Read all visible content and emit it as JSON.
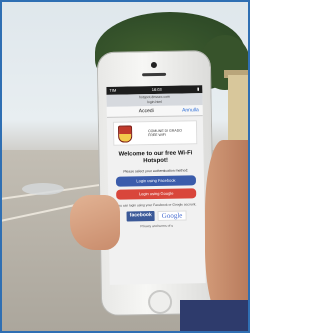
{
  "phone_screen": {
    "status": {
      "time": "16:03",
      "carrier": "TIM"
    },
    "browser": {
      "url_line1": "hotspot.dnssec.com",
      "url_line2": "login.html"
    },
    "nav": {
      "title": "Accedi",
      "cancel": "Annulla"
    },
    "city_card": {
      "line1": "COMUNE DI GRADO",
      "line2": "FREE WIFI"
    },
    "welcome": "Welcome to our free Wi-Fi Hotspot!",
    "auth_prompt": "Please select your authentication method:",
    "buttons": {
      "facebook": "Login using Facebook",
      "google": "Login using Google"
    },
    "hint": "You can login using your Facebook or Google account.",
    "logos": {
      "facebook": "facebook",
      "google": "Google"
    },
    "privacy": "Privacy and terms of u"
  },
  "colors": {
    "facebook": "#3b5cab",
    "google": "#d9463b",
    "frame": "#2f6fb3"
  }
}
